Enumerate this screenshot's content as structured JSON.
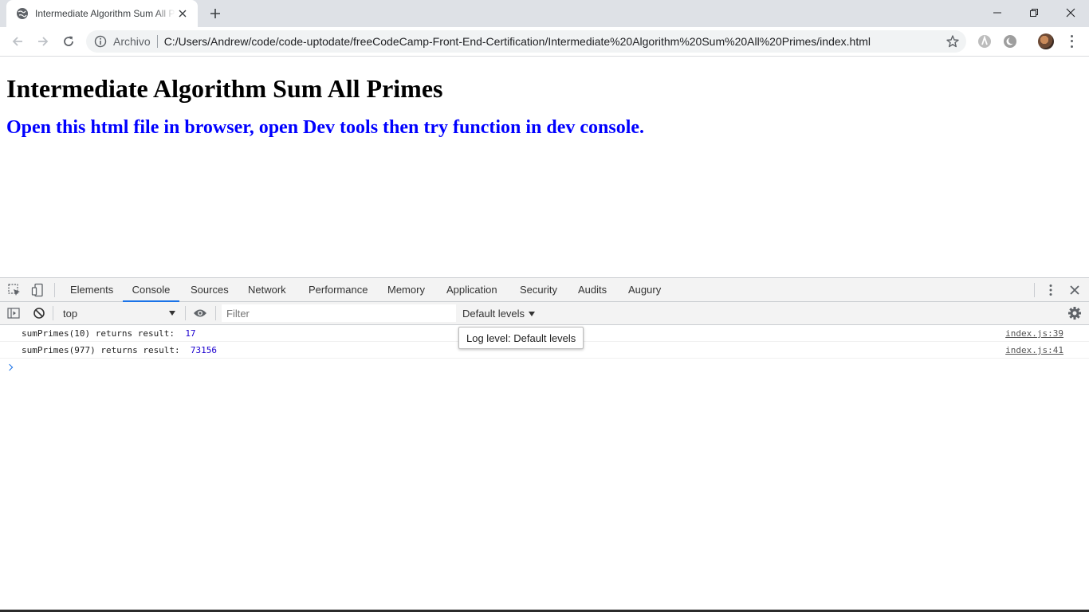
{
  "browser": {
    "tab_title": "Intermediate Algorithm Sum All Primes",
    "address": {
      "scheme_label": "Archivo",
      "url": "C:/Users/Andrew/code/code-uptodate/freeCodeCamp-Front-End-Certification/Intermediate%20Algorithm%20Sum%20All%20Primes/index.html"
    }
  },
  "page": {
    "heading": "Intermediate Algorithm Sum All Primes",
    "subheading": "Open this html file in browser, open Dev tools then try function in dev console.",
    "subheading_color": "#0000ff"
  },
  "devtools": {
    "tabs": [
      "Elements",
      "Console",
      "Sources",
      "Network",
      "Performance",
      "Memory",
      "Application",
      "Security",
      "Audits",
      "Augury"
    ],
    "active_tab": "Console",
    "accent_color": "#1a73e8",
    "context": "top",
    "filter_placeholder": "Filter",
    "levels_label": "Default levels",
    "tooltip": "Log level: Default levels",
    "logs": [
      {
        "text": "sumPrimes(10) returns result:  ",
        "value": "17",
        "source": "index.js:39"
      },
      {
        "text": "sumPrimes(977) returns result:  ",
        "value": "73156",
        "source": "index.js:41"
      }
    ]
  }
}
